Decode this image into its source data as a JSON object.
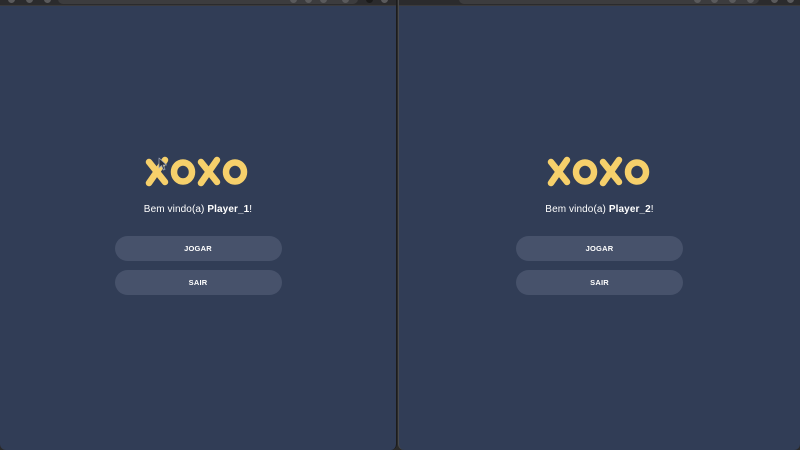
{
  "windows": [
    {
      "logo_text": "XOXO",
      "welcome_prefix": "Bem vindo(a) ",
      "player_name": "Player_1",
      "welcome_suffix": "!",
      "buttons": {
        "play_label": "JOGAR",
        "exit_label": "SAIR"
      }
    },
    {
      "logo_text": "XOXO",
      "welcome_prefix": "Bem vindo(a) ",
      "player_name": "Player_2",
      "welcome_suffix": "!",
      "buttons": {
        "play_label": "JOGAR",
        "exit_label": "SAIR"
      }
    }
  ],
  "colors": {
    "background": "#313d56",
    "button": "#47526b",
    "logo": "#f6d06b",
    "text": "#ffffff"
  },
  "icons": [
    "mouse-cursor-icon"
  ]
}
